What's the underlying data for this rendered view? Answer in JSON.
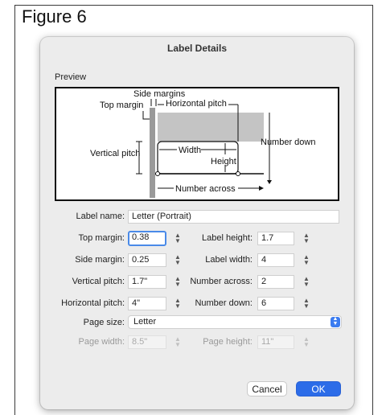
{
  "figure_title": "Figure 6",
  "dialog": {
    "title": "Label Details",
    "preview_label": "Preview",
    "diagram": {
      "side_margins": "Side margins",
      "top_margin": "Top margin",
      "horizontal_pitch": "Horizontal pitch",
      "vertical_pitch": "Vertical pitch",
      "width": "Width",
      "height": "Height",
      "number_down": "Number down",
      "number_across": "Number across"
    },
    "label_name": {
      "label": "Label name:",
      "value": "Letter (Portrait)"
    },
    "top_margin": {
      "label": "Top margin:",
      "value": "0.38"
    },
    "label_height": {
      "label": "Label height:",
      "value": "1.7"
    },
    "side_margin": {
      "label": "Side margin:",
      "value": "0.25"
    },
    "label_width": {
      "label": "Label width:",
      "value": "4"
    },
    "vertical_pitch": {
      "label": "Vertical pitch:",
      "value": "1.7\""
    },
    "number_across": {
      "label": "Number across:",
      "value": "2"
    },
    "horizontal_pitch": {
      "label": "Horizontal pitch:",
      "value": "4\""
    },
    "number_down": {
      "label": "Number down:",
      "value": "6"
    },
    "page_size": {
      "label": "Page size:",
      "value": "Letter"
    },
    "page_width": {
      "label": "Page width:",
      "value": "8.5\""
    },
    "page_height": {
      "label": "Page height:",
      "value": "11\""
    },
    "buttons": {
      "cancel": "Cancel",
      "ok": "OK"
    }
  },
  "colors": {
    "accent": "#2c6ce8",
    "focus_ring": "#4a8ae8",
    "dialog_bg": "#ececec"
  }
}
